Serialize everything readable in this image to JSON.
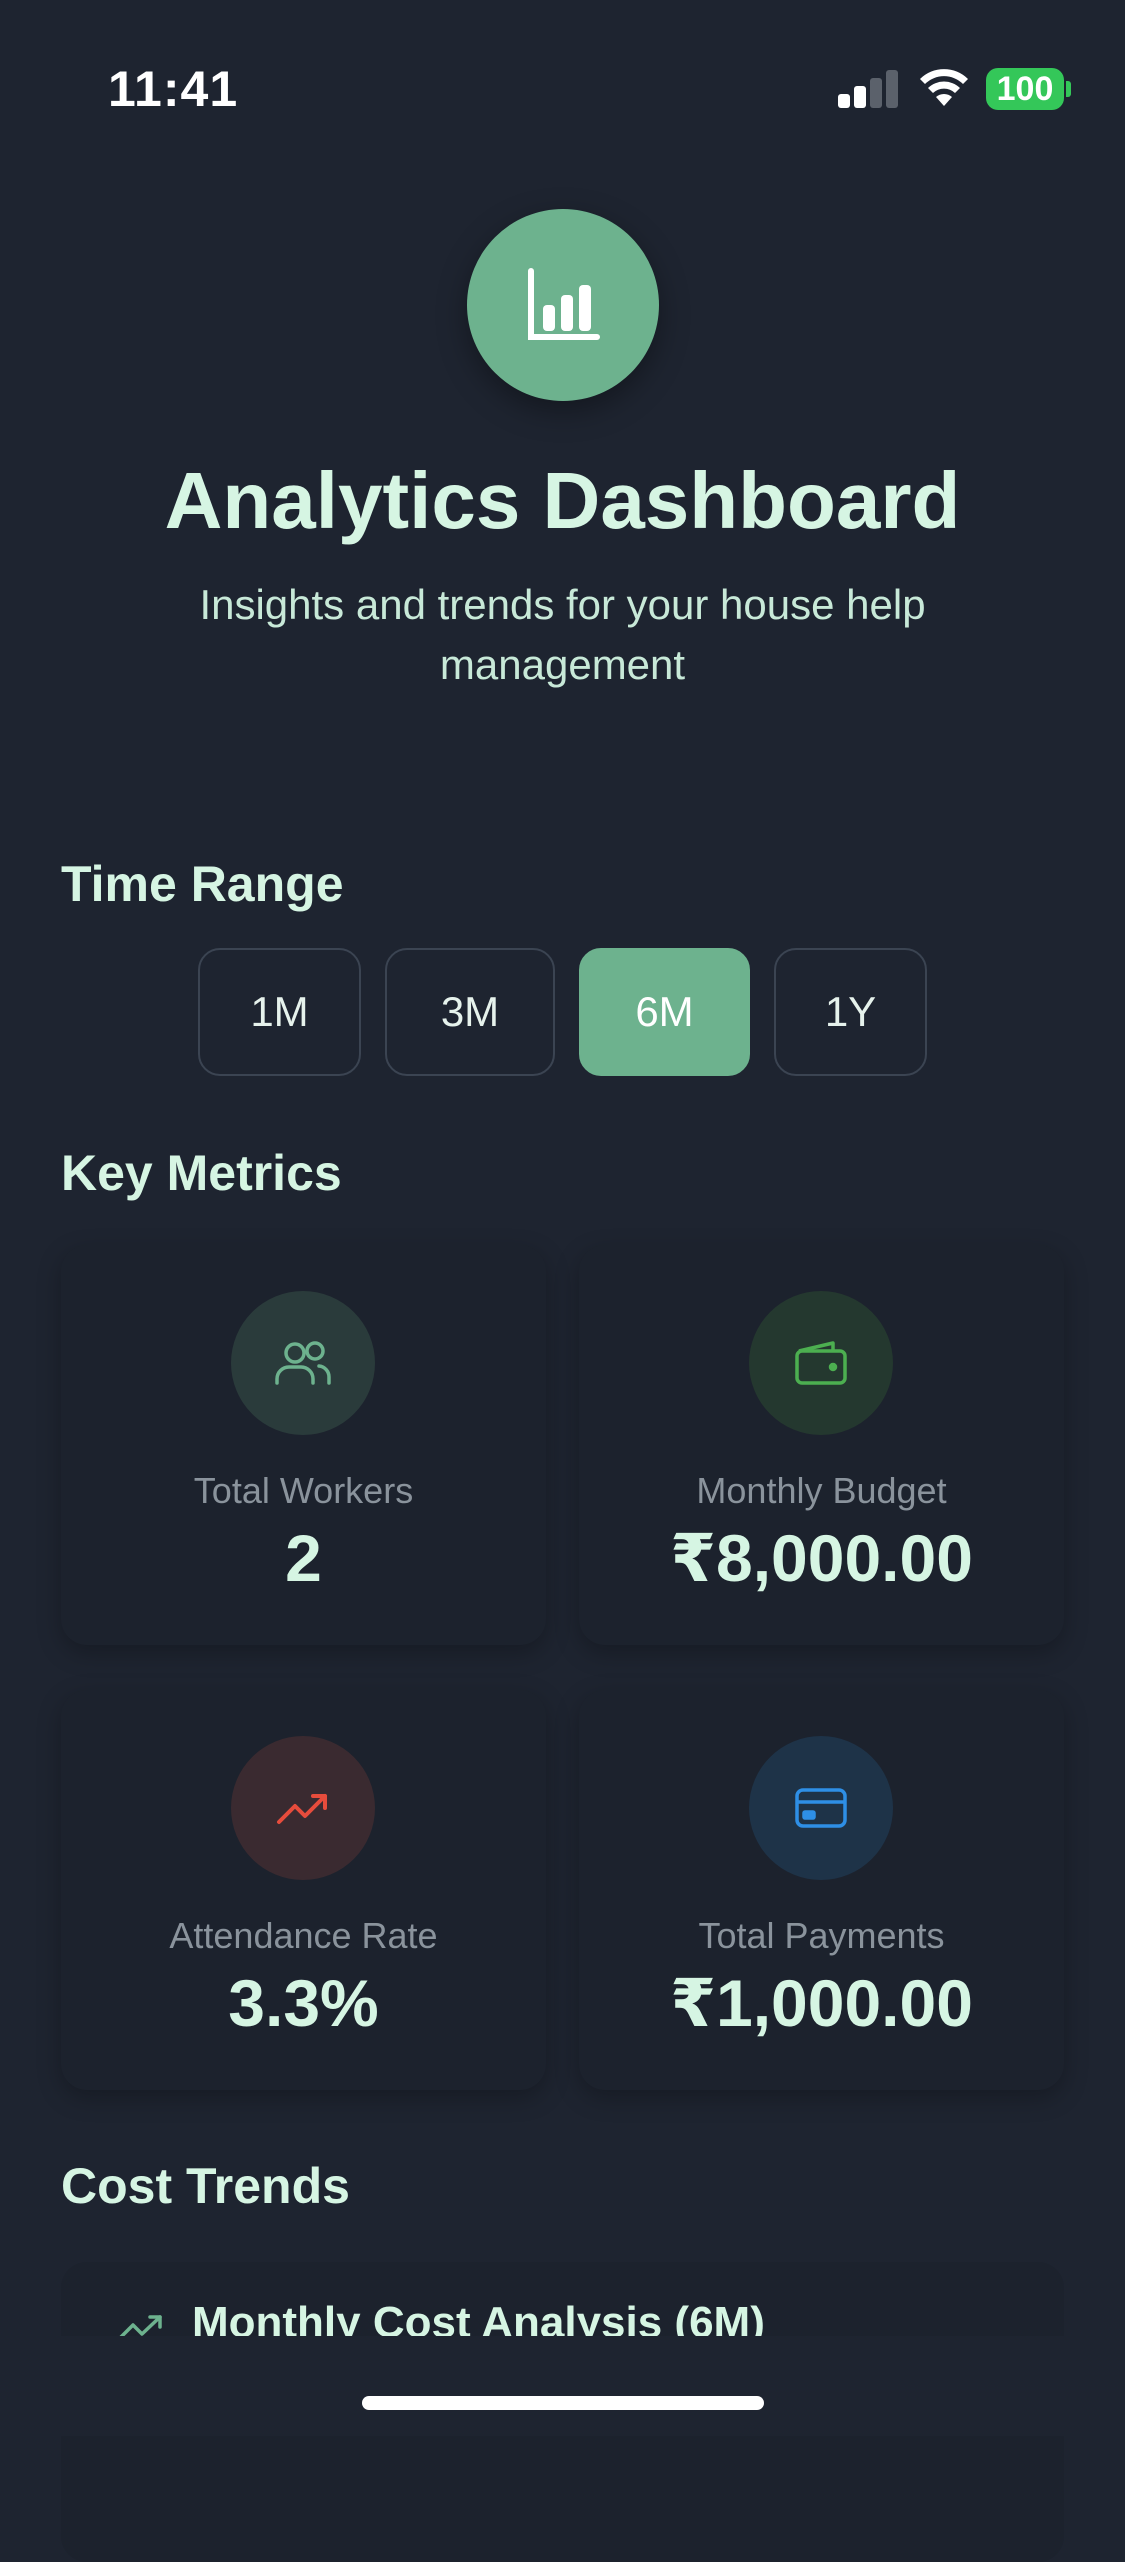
{
  "status": {
    "time": "11:41",
    "battery": "100"
  },
  "header": {
    "icon": "bar-chart-icon",
    "title": "Analytics Dashboard",
    "subtitle": "Insights and trends for your house help management"
  },
  "time_range": {
    "title": "Time Range",
    "options": [
      "1M",
      "3M",
      "6M",
      "1Y"
    ],
    "selected": "6M"
  },
  "metrics": {
    "title": "Key Metrics",
    "items": [
      {
        "label": "Total Workers",
        "value": "2",
        "icon": "users-icon",
        "color": "#6db28e"
      },
      {
        "label": "Monthly Budget",
        "value": "₹8,000.00",
        "icon": "wallet-icon",
        "color": "#4caf50"
      },
      {
        "label": "Attendance Rate",
        "value": "3.3%",
        "icon": "trending-up-icon",
        "color": "#e74c3c"
      },
      {
        "label": "Total Payments",
        "value": "₹1,000.00",
        "icon": "credit-card-icon",
        "color": "#2e8fe6"
      }
    ]
  },
  "cost_trends": {
    "title": "Cost Trends",
    "card_title": "Monthly Cost Analysis (6M)",
    "icon": "trending-up-icon"
  },
  "colors": {
    "background": "#1e2430",
    "accent": "#6db28e",
    "text": "#d6f5e3"
  }
}
